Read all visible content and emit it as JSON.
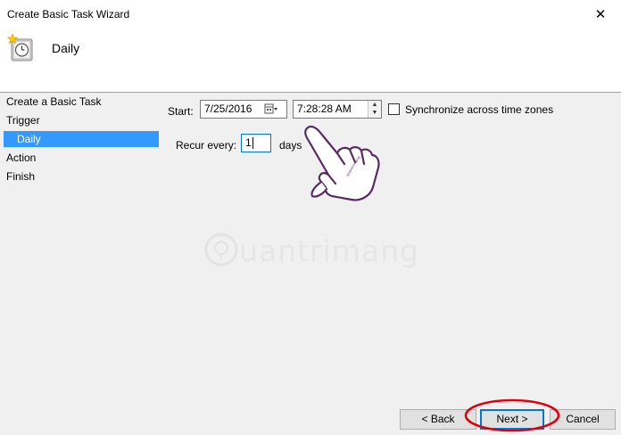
{
  "window": {
    "title": "Create Basic Task Wizard",
    "close_glyph": "✕"
  },
  "header": {
    "title": "Daily",
    "icon": "task-scheduler-clock-icon"
  },
  "sidebar": {
    "items": [
      {
        "label": "Create a Basic Task",
        "selected": false
      },
      {
        "label": "Trigger",
        "selected": false
      },
      {
        "label": "Daily",
        "selected": true
      },
      {
        "label": "Action",
        "selected": false
      },
      {
        "label": "Finish",
        "selected": false
      }
    ]
  },
  "form": {
    "start_label": "Start:",
    "start_date": "7/25/2016",
    "start_time": "7:28:28 AM",
    "sync_label": "Synchronize across time zones",
    "sync_checked": false,
    "recur_label": "Recur every:",
    "recur_value": "1",
    "recur_unit": "days"
  },
  "overlay": {
    "watermark_text": "uantrimang",
    "hand_icon": "pointing-hand-icon"
  },
  "footer": {
    "back_label": "< Back",
    "next_label": "Next >",
    "cancel_label": "Cancel"
  },
  "colors": {
    "selection": "#3399ff",
    "annotation_red": "#e0000a",
    "hand_purple": "#5a2a62"
  }
}
